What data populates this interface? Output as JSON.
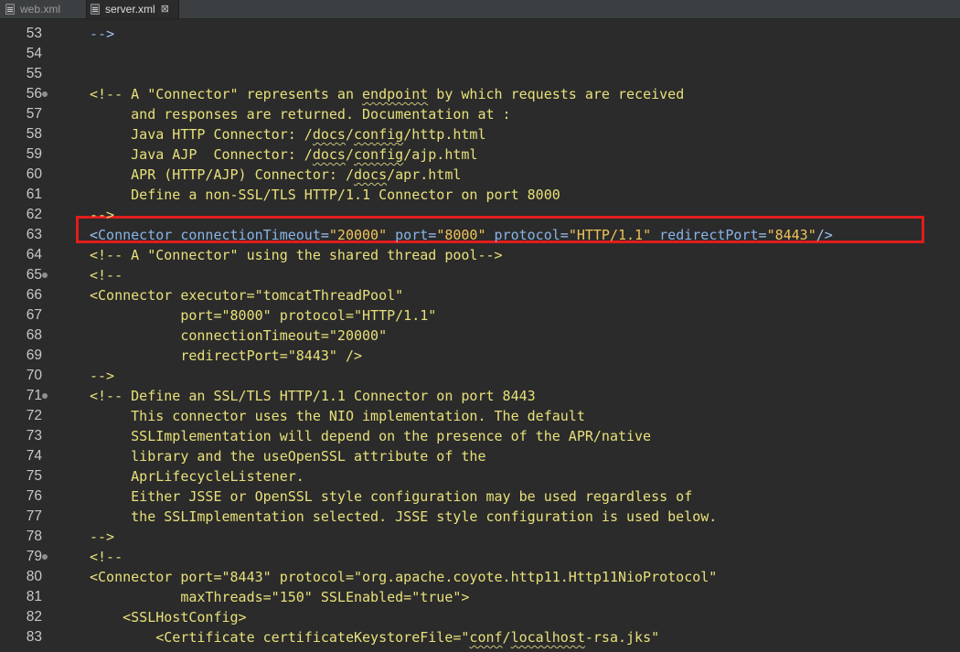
{
  "tabs": [
    {
      "label": "web.xml",
      "active": false,
      "icon": "xml-file-icon"
    },
    {
      "label": "server.xml",
      "active": true,
      "icon": "xml-file-icon",
      "close": "⊠"
    }
  ],
  "colors": {
    "background": "#2b2b2b",
    "comment": "#e8e07a",
    "tag": "#8ab4e8",
    "attribute_value": "#f0c45a",
    "highlight_border": "#e11d1d"
  },
  "highlighted_line": 63,
  "lines": [
    {
      "n": "53",
      "fold": false,
      "code": "-->"
    },
    {
      "n": "54",
      "fold": false,
      "code": ""
    },
    {
      "n": "55",
      "fold": false,
      "code": ""
    },
    {
      "n": "56",
      "fold": true,
      "code": "<!-- A \"Connector\" represents an endpoint by which requests are received"
    },
    {
      "n": "57",
      "fold": false,
      "code": "     and responses are returned. Documentation at :"
    },
    {
      "n": "58",
      "fold": false,
      "code": "     Java HTTP Connector: /docs/config/http.html"
    },
    {
      "n": "59",
      "fold": false,
      "code": "     Java AJP  Connector: /docs/config/ajp.html"
    },
    {
      "n": "60",
      "fold": false,
      "code": "     APR (HTTP/AJP) Connector: /docs/apr.html"
    },
    {
      "n": "61",
      "fold": false,
      "code": "     Define a non-SSL/TLS HTTP/1.1 Connector on port 8000"
    },
    {
      "n": "62",
      "fold": false,
      "code": "-->"
    },
    {
      "n": "63",
      "fold": false,
      "code": "<Connector connectionTimeout=\"20000\" port=\"8000\" protocol=\"HTTP/1.1\" redirectPort=\"8443\"/>"
    },
    {
      "n": "64",
      "fold": false,
      "code": "<!-- A \"Connector\" using the shared thread pool-->"
    },
    {
      "n": "65",
      "fold": true,
      "code": "<!--"
    },
    {
      "n": "66",
      "fold": false,
      "code": "<Connector executor=\"tomcatThreadPool\""
    },
    {
      "n": "67",
      "fold": false,
      "code": "           port=\"8000\" protocol=\"HTTP/1.1\""
    },
    {
      "n": "68",
      "fold": false,
      "code": "           connectionTimeout=\"20000\""
    },
    {
      "n": "69",
      "fold": false,
      "code": "           redirectPort=\"8443\" />"
    },
    {
      "n": "70",
      "fold": false,
      "code": "-->"
    },
    {
      "n": "71",
      "fold": true,
      "code": "<!-- Define an SSL/TLS HTTP/1.1 Connector on port 8443"
    },
    {
      "n": "72",
      "fold": false,
      "code": "     This connector uses the NIO implementation. The default"
    },
    {
      "n": "73",
      "fold": false,
      "code": "     SSLImplementation will depend on the presence of the APR/native"
    },
    {
      "n": "74",
      "fold": false,
      "code": "     library and the useOpenSSL attribute of the"
    },
    {
      "n": "75",
      "fold": false,
      "code": "     AprLifecycleListener."
    },
    {
      "n": "76",
      "fold": false,
      "code": "     Either JSSE or OpenSSL style configuration may be used regardless of"
    },
    {
      "n": "77",
      "fold": false,
      "code": "     the SSLImplementation selected. JSSE style configuration is used below."
    },
    {
      "n": "78",
      "fold": false,
      "code": "-->"
    },
    {
      "n": "79",
      "fold": true,
      "code": "<!--"
    },
    {
      "n": "80",
      "fold": false,
      "code": "<Connector port=\"8443\" protocol=\"org.apache.coyote.http11.Http11NioProtocol\""
    },
    {
      "n": "81",
      "fold": false,
      "code": "           maxThreads=\"150\" SSLEnabled=\"true\">"
    },
    {
      "n": "82",
      "fold": false,
      "code": "    <SSLHostConfig>"
    },
    {
      "n": "83",
      "fold": false,
      "code": "        <Certificate certificateKeystoreFile=\"conf/localhost-rsa.jks\""
    }
  ]
}
